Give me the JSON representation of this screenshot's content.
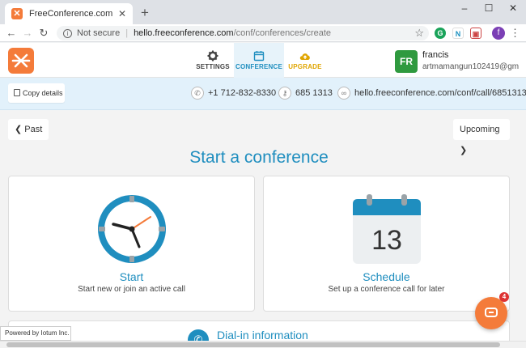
{
  "browser": {
    "tab_title": "FreeConference.com",
    "new_tab": "+",
    "address": {
      "security": "Not secure",
      "host": "hello.freeconference.com",
      "path": "/conf/conferences/create"
    },
    "profile_initial": "f"
  },
  "header": {
    "nav": [
      {
        "label": "SETTINGS"
      },
      {
        "label": "CONFERENCE"
      },
      {
        "label": "UPGRADE"
      }
    ],
    "user": {
      "initials": "FR",
      "name": "francis",
      "email": "artmamangun102419@gm"
    }
  },
  "details": {
    "copy_label": "Copy details",
    "phone": "+1 712-832-8330",
    "access_code": "685 1313",
    "url": "hello.freeconference.com/conf/call/6851313"
  },
  "main": {
    "past_label": "Past",
    "upcoming_label": "Upcoming",
    "title": "Start a conference",
    "cards": [
      {
        "title": "Start",
        "subtitle": "Start new or join an active call"
      },
      {
        "title": "Schedule",
        "subtitle": "Set up a conference call for later",
        "calendar_day": "13"
      }
    ],
    "dialin_title": "Dial-in information"
  },
  "footer": {
    "powered_by": "Powered by Iotum Inc.",
    "chat_badge": "4"
  },
  "colors": {
    "accent": "#1f8ebf",
    "brand_orange": "#f47b3a",
    "upgrade_gold": "#e0a500",
    "avatar_green": "#2f9a3f"
  }
}
